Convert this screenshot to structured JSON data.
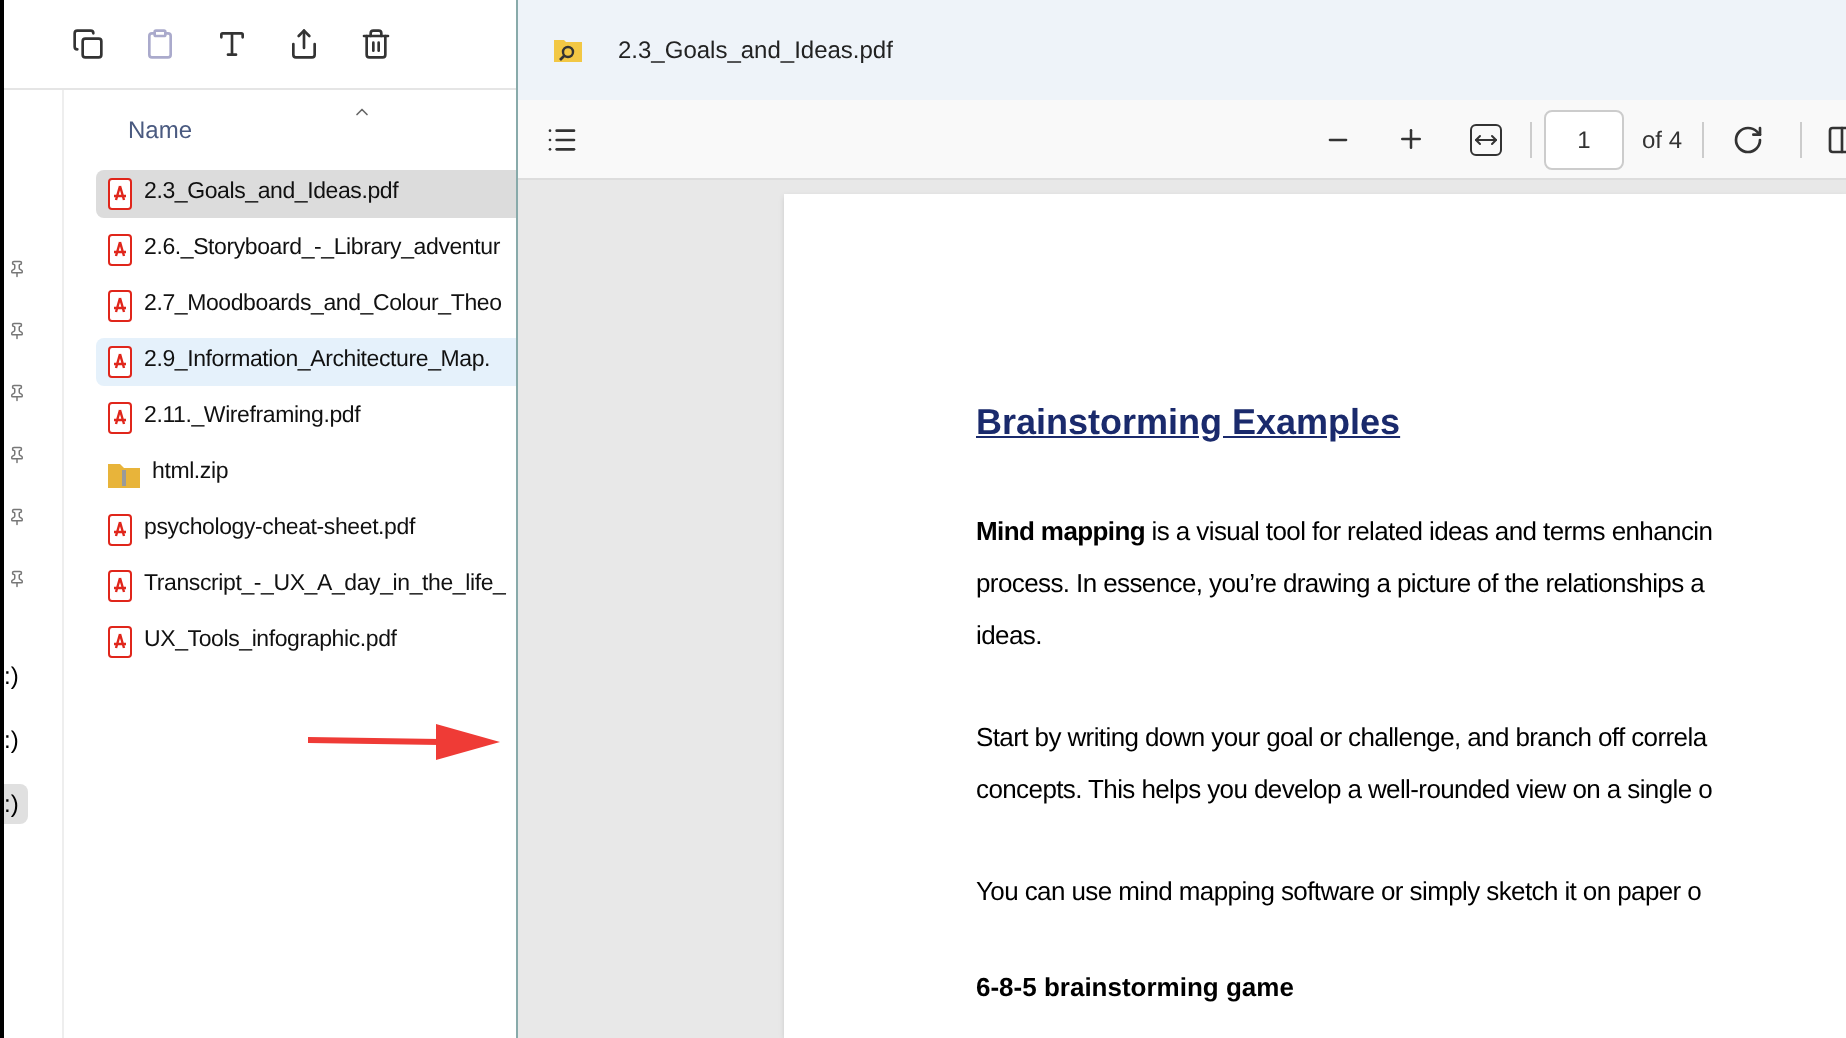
{
  "explorer": {
    "column_header": "Name",
    "files": [
      {
        "name": "2.3_Goals_and_Ideas.pdf",
        "kind": "pdf",
        "selected": true,
        "hovered": false
      },
      {
        "name": "2.6._Storyboard_-_Library_adventur",
        "kind": "pdf",
        "selected": false,
        "hovered": false
      },
      {
        "name": "2.7_Moodboards_and_Colour_Theo",
        "kind": "pdf",
        "selected": false,
        "hovered": false
      },
      {
        "name": "2.9_Information_Architecture_Map.",
        "kind": "pdf",
        "selected": false,
        "hovered": true
      },
      {
        "name": "2.11._Wireframing.pdf",
        "kind": "pdf",
        "selected": false,
        "hovered": false
      },
      {
        "name": "html.zip",
        "kind": "zip",
        "selected": false,
        "hovered": false
      },
      {
        "name": "psychology-cheat-sheet.pdf",
        "kind": "pdf",
        "selected": false,
        "hovered": false
      },
      {
        "name": "Transcript_-_UX_A_day_in_the_life_",
        "kind": "pdf",
        "selected": false,
        "hovered": false
      },
      {
        "name": "UX_Tools_infographic.pdf",
        "kind": "pdf",
        "selected": false,
        "hovered": false
      }
    ],
    "nav_fragments": [
      {
        "text": ":)",
        "selected": false
      },
      {
        "text": ":)",
        "selected": false
      },
      {
        "text": ":)",
        "selected": true
      }
    ]
  },
  "viewer": {
    "title": "2.3_Goals_and_Ideas.pdf",
    "page_number": "1",
    "page_count": "of 4",
    "heading": "Brainstorming Examples",
    "paragraphs": [
      {
        "kind": "text",
        "lines": [
          "**Mind mapping** is a visual tool for related ideas and terms enhancin",
          "process. In essence, you’re drawing a picture of the relationships a",
          "ideas."
        ]
      },
      {
        "kind": "text",
        "lines": [
          "Start by writing down your goal or challenge, and branch off correla",
          "concepts. This helps you develop a well-rounded view on a single o"
        ]
      },
      {
        "kind": "text",
        "lines": [
          "You can use mind mapping software or simply sketch it on paper o"
        ]
      },
      {
        "kind": "subheading",
        "lines": [
          "6-8-5 brainstorming game"
        ]
      }
    ]
  }
}
